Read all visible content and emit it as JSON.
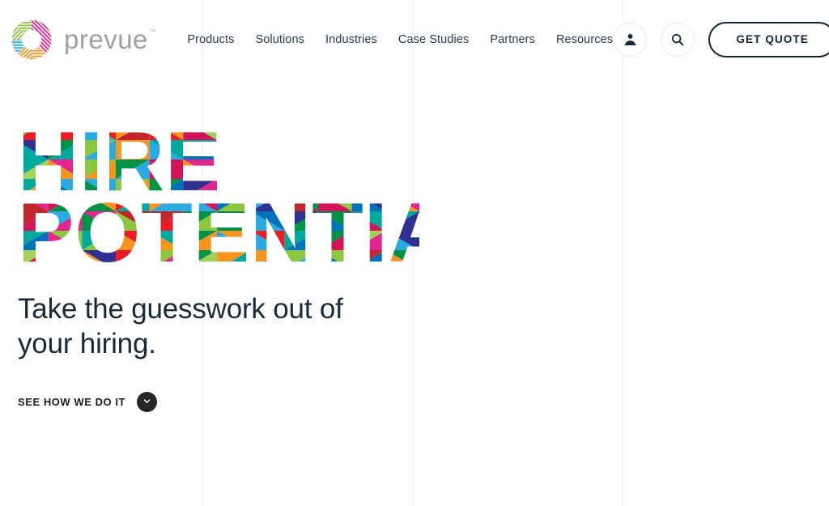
{
  "brand": {
    "name": "prevue",
    "trademark": "™",
    "logo_icon": "prevue-ring-logo"
  },
  "nav": {
    "items": [
      {
        "label": "Products"
      },
      {
        "label": "Solutions"
      },
      {
        "label": "Industries"
      },
      {
        "label": "Case Studies"
      },
      {
        "label": "Partners"
      },
      {
        "label": "Resources"
      }
    ]
  },
  "header_actions": {
    "account_icon": "user-icon",
    "search_icon": "search-icon",
    "quote_label": "GET QUOTE"
  },
  "hero": {
    "headline_line1": "HIRE",
    "headline_line2": "POTENTIAL",
    "subheadline_line1": "Take the guesswork out of",
    "subheadline_line2": "your hiring.",
    "cta_label": "SEE HOW WE DO IT",
    "cta_icon": "chevron-down-icon"
  },
  "colors": {
    "ink": "#0f2236",
    "nav_text": "#2b3b4d",
    "wordmark": "#9d9fa2",
    "gridline": "#eceef0",
    "cta_circle": "#262626",
    "palette": [
      "#e5258e",
      "#8dc63f",
      "#f7941e",
      "#29abe2",
      "#ed1c24",
      "#009245",
      "#2e3192",
      "#c1272d",
      "#00a99d",
      "#a3d159",
      "#d4145a",
      "#0071bc"
    ]
  },
  "layout": {
    "gridline_x": [
      250,
      510,
      768
    ]
  }
}
